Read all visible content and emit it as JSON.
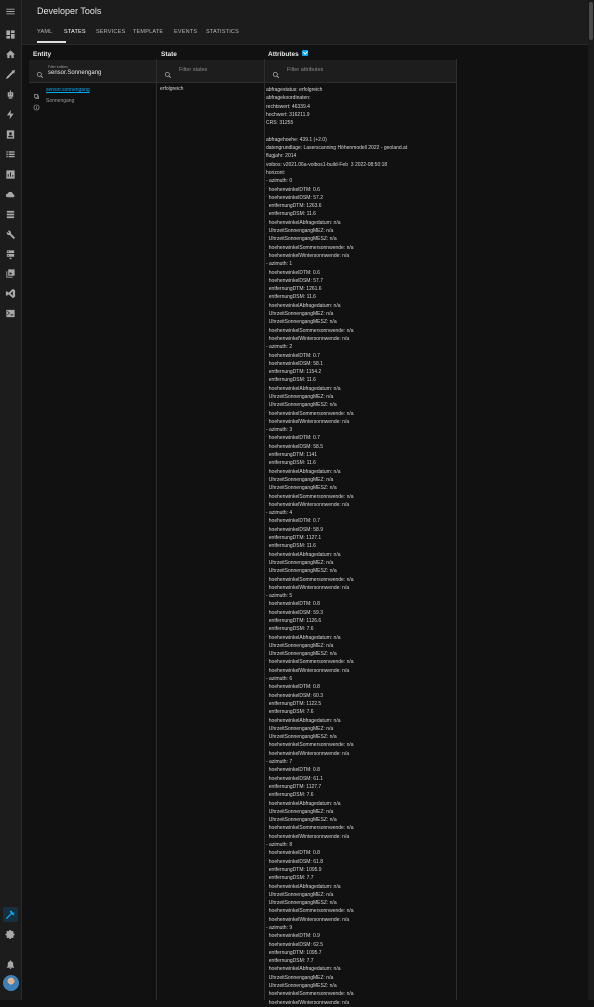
{
  "header": {
    "title": "Developer Tools",
    "tabs": [
      {
        "label": "YAML",
        "active": false
      },
      {
        "label": "STATES",
        "active": true
      },
      {
        "label": "SERVICES",
        "active": false
      },
      {
        "label": "TEMPLATE",
        "active": false
      },
      {
        "label": "EVENTS",
        "active": false
      },
      {
        "label": "STATISTICS",
        "active": false
      }
    ]
  },
  "sidebar": {
    "items": [
      {
        "icon": "menu-icon"
      },
      {
        "icon": "dashboard-icon"
      },
      {
        "icon": "home-icon"
      },
      {
        "icon": "rocket-icon"
      },
      {
        "icon": "robot-icon"
      },
      {
        "icon": "lightning-icon"
      },
      {
        "icon": "chart-icon"
      },
      {
        "icon": "badge-icon"
      },
      {
        "icon": "list-icon"
      },
      {
        "icon": "box-icon"
      },
      {
        "icon": "cloud-icon"
      },
      {
        "icon": "storage-icon"
      },
      {
        "icon": "wrench-icon"
      },
      {
        "icon": "server-icon"
      },
      {
        "icon": "media-icon"
      },
      {
        "icon": "vscode-icon"
      },
      {
        "icon": "terminal-icon"
      },
      {
        "icon": "hammer-icon",
        "active": true
      },
      {
        "icon": "gear-icon"
      },
      {
        "icon": "bell-icon"
      }
    ],
    "accent": "#03a9f4"
  },
  "table": {
    "entity_header": "Entity",
    "state_header": "State",
    "attributes_header": "Attributes",
    "attributes_checked": true,
    "filter_entities_label": "Filter entities",
    "filter_entities_value": "sensor.Sonnengang",
    "filter_states_placeholder": "Filter states",
    "filter_attributes_placeholder": "Filter attributes",
    "row": {
      "entity_id": "sensor.sonnengang",
      "friendly_name": "Sonnengang",
      "state": "erfolgreich",
      "attributes": [
        "abfragestatus: erfolgreich",
        "abfragekoordinaten:",
        "rechtswert: 46339.4",
        "hochwert: 316211.9",
        "CRS: 31255",
        "",
        "abfragehoehe: 439.1 (+2.0)",
        "datengrundlage: Laserscanning Höhenmodell 2022 - geoland.at",
        "flugjahr: 2014",
        "voibos: v2021.06a-voibos1-build-Feb  3 2022-08:50:18",
        "horizont:",
        "- azimuth: 0",
        "  hoehenwinkelDTM: 0.6",
        "  hoehenwinkelDSM: 57.2",
        "  entfernungDTM: 1263.6",
        "  entfernungDSM: 11.6",
        "  hoehenwinkelAbfragedatum: n/a",
        "  UhrzeitSonnengangMEZ: n/a",
        "  UhrzeitSonnengangMESZ: n/a",
        "  hoehenwinkelSommersonnwende: n/a",
        "  hoehenwinkelWintersonnwende: n/a",
        "- azimuth: 1",
        "  hoehenwinkelDTM: 0.6",
        "  hoehenwinkelDSM: 57.7",
        "  entfernungDTM: 1261.6",
        "  entfernungDSM: 11.6",
        "  hoehenwinkelAbfragedatum: n/a",
        "  UhrzeitSonnengangMEZ: n/a",
        "  UhrzeitSonnengangMESZ: n/a",
        "  hoehenwinkelSommersonnwende: n/a",
        "  hoehenwinkelWintersonnwende: n/a",
        "- azimuth: 2",
        "  hoehenwinkelDTM: 0.7",
        "  hoehenwinkelDSM: 58.1",
        "  entfernungDTM: 1154.2",
        "  entfernungDSM: 11.6",
        "  hoehenwinkelAbfragedatum: n/a",
        "  UhrzeitSonnengangMEZ: n/a",
        "  UhrzeitSonnengangMESZ: n/a",
        "  hoehenwinkelSommersonnwende: n/a",
        "  hoehenwinkelWintersonnwende: n/a",
        "- azimuth: 3",
        "  hoehenwinkelDTM: 0.7",
        "  hoehenwinkelDSM: 58.5",
        "  entfernungDTM: 1141",
        "  entfernungDSM: 11.6",
        "  hoehenwinkelAbfragedatum: n/a",
        "  UhrzeitSonnengangMEZ: n/a",
        "  UhrzeitSonnengangMESZ: n/a",
        "  hoehenwinkelSommersonnwende: n/a",
        "  hoehenwinkelWintersonnwende: n/a",
        "- azimuth: 4",
        "  hoehenwinkelDTM: 0.7",
        "  hoehenwinkelDSM: 58.9",
        "  entfernungDTM: 1127.1",
        "  entfernungDSM: 11.6",
        "  hoehenwinkelAbfragedatum: n/a",
        "  UhrzeitSonnengangMEZ: n/a",
        "  UhrzeitSonnengangMESZ: n/a",
        "  hoehenwinkelSommersonnwende: n/a",
        "  hoehenwinkelWintersonnwende: n/a",
        "- azimuth: 5",
        "  hoehenwinkelDTM: 0.8",
        "  hoehenwinkelDSM: 59.3",
        "  entfernungDTM: 1126.6",
        "  entfernungDSM: 7.6",
        "  hoehenwinkelAbfragedatum: n/a",
        "  UhrzeitSonnengangMEZ: n/a",
        "  UhrzeitSonnengangMESZ: n/a",
        "  hoehenwinkelSommersonnwende: n/a",
        "  hoehenwinkelWintersonnwende: n/a",
        "- azimuth: 6",
        "  hoehenwinkelDTM: 0.8",
        "  hoehenwinkelDSM: 60.3",
        "  entfernungDTM: 1122.5",
        "  entfernungDSM: 7.6",
        "  hoehenwinkelAbfragedatum: n/a",
        "  UhrzeitSonnengangMEZ: n/a",
        "  UhrzeitSonnengangMESZ: n/a",
        "  hoehenwinkelSommersonnwende: n/a",
        "  hoehenwinkelWintersonnwende: n/a",
        "- azimuth: 7",
        "  hoehenwinkelDTM: 0.8",
        "  hoehenwinkelDSM: 61.1",
        "  entfernungDTM: 1127.7",
        "  entfernungDSM: 7.6",
        "  hoehenwinkelAbfragedatum: n/a",
        "  UhrzeitSonnengangMEZ: n/a",
        "  UhrzeitSonnengangMESZ: n/a",
        "  hoehenwinkelSommersonnwende: n/a",
        "  hoehenwinkelWintersonnwende: n/a",
        "- azimuth: 8",
        "  hoehenwinkelDTM: 0.8",
        "  hoehenwinkelDSM: 61.8",
        "  entfernungDTM: 1095.9",
        "  entfernungDSM: 7.7",
        "  hoehenwinkelAbfragedatum: n/a",
        "  UhrzeitSonnengangMEZ: n/a",
        "  UhrzeitSonnengangMESZ: n/a",
        "  hoehenwinkelSommersonnwende: n/a",
        "  hoehenwinkelWintersonnwende: n/a",
        "- azimuth: 9",
        "  hoehenwinkelDTM: 0.9",
        "  hoehenwinkelDSM: 62.5",
        "  entfernungDTM: 1095.7",
        "  entfernungDSM: 7.7",
        "  hoehenwinkelAbfragedatum: n/a",
        "  UhrzeitSonnengangMEZ: n/a",
        "  UhrzeitSonnengangMESZ: n/a",
        "  hoehenwinkelSommersonnwende: n/a",
        "  hoehenwinkelWintersonnwende: n/a"
      ]
    }
  }
}
